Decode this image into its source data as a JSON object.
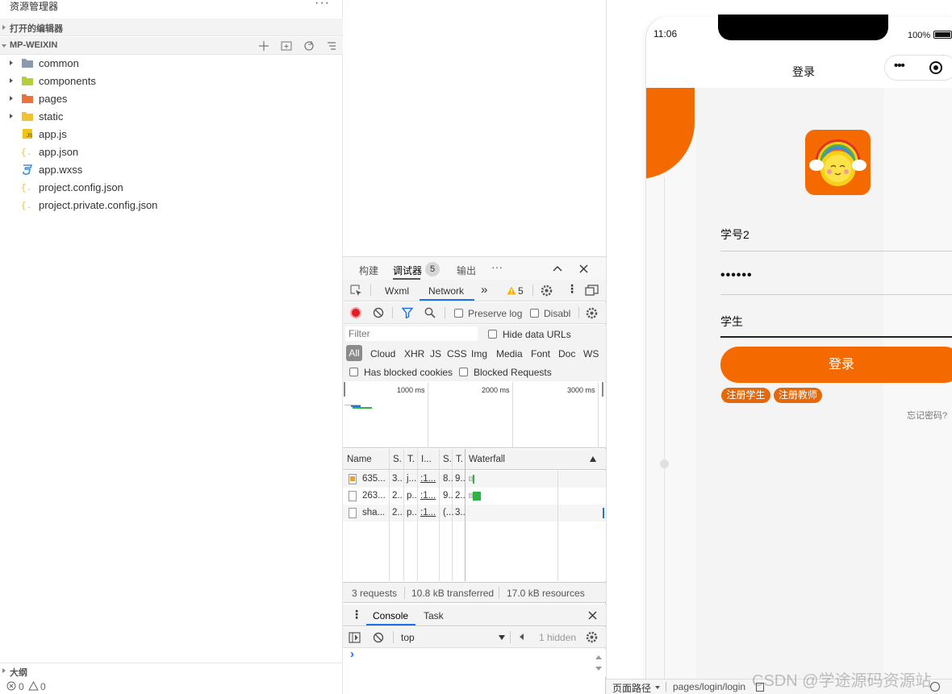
{
  "explorer": {
    "title": "资源管理器",
    "more": "···",
    "open_editors": "打开的编辑器",
    "project": "MP-WEIXIN",
    "items": [
      {
        "name": "common",
        "icon": "folder-icon",
        "color": "#8a9ab0",
        "expandable": true
      },
      {
        "name": "components",
        "icon": "folder-components-icon",
        "color": "#b5cf3a",
        "expandable": true
      },
      {
        "name": "pages",
        "icon": "folder-pages-icon",
        "color": "#e8743b",
        "expandable": true
      },
      {
        "name": "static",
        "icon": "folder-static-icon",
        "color": "#f2c12e",
        "expandable": true
      },
      {
        "name": "app.js",
        "icon": "js-file-icon",
        "color": "#f0c419",
        "expandable": false
      },
      {
        "name": "app.json",
        "icon": "json-file-icon",
        "color": "#f0c419",
        "expandable": false
      },
      {
        "name": "app.wxss",
        "icon": "css-file-icon",
        "color": "#3b8ede",
        "expandable": false
      },
      {
        "name": "project.config.json",
        "icon": "json-file-icon",
        "color": "#f0c419",
        "expandable": false
      },
      {
        "name": "project.private.config.json",
        "icon": "json-file-icon",
        "color": "#f0c419",
        "expandable": false
      }
    ],
    "outline": "大纲",
    "status_errors": "0",
    "status_warnings": "0"
  },
  "devtools": {
    "top_tabs": [
      "构建",
      "调试器",
      "输出"
    ],
    "debugger_badge": "5",
    "more": "···",
    "panel_tabs": [
      "Wxml",
      "Network"
    ],
    "overflow": "»",
    "warn_count": "5",
    "preserve_log": "Preserve log",
    "disable_cache": "Disabl",
    "filter_placeholder": "Filter",
    "hide_data_urls": "Hide data URLs",
    "types": [
      "All",
      "Cloud",
      "XHR",
      "JS",
      "CSS",
      "Img",
      "Media",
      "Font",
      "Doc",
      "WS"
    ],
    "blocked_cookies": "Has blocked cookies",
    "blocked_requests": "Blocked Requests",
    "overview_ticks": [
      "1000 ms",
      "2000 ms",
      "3000 ms"
    ],
    "columns": [
      "Name",
      "S.",
      "T.",
      "I...",
      "S.",
      "T.",
      "Waterfall"
    ],
    "rows": [
      {
        "name": "635...",
        "status": "3..",
        "type": "j...",
        "initiator": ":1...",
        "size": "8..",
        "time": "9..",
        "icon": "image-file-icon"
      },
      {
        "name": "263...",
        "status": "2..",
        "type": "p..",
        "initiator": ":1...",
        "size": "9..",
        "time": "2..",
        "icon": "doc-file-icon"
      },
      {
        "name": "sha...",
        "status": "2..",
        "type": "p..",
        "initiator": ":1...",
        "size": "(...",
        "time": "3..",
        "icon": "doc-file-icon"
      }
    ],
    "summary": [
      "3 requests",
      "10.8 kB transferred",
      "17.0 kB resources"
    ],
    "console_tabs": [
      "Console",
      "Task"
    ],
    "context": "top",
    "hidden": "1 hidden",
    "prompt": "›"
  },
  "simulator": {
    "time": "11:06",
    "battery": "100%",
    "nav_title": "登录",
    "capsule_dots": "•••",
    "username": "学号2",
    "password": "••••••",
    "role": "学生",
    "login_button": "登录",
    "register_student": "注册学生",
    "register_teacher": "注册教师",
    "forgot": "忘记密码?",
    "accent": "#f56a00"
  },
  "bottom_bar": {
    "page_path_label": "页面路径",
    "page_path": "pages/login/login"
  },
  "watermark": "CSDN @学途源码资源站"
}
